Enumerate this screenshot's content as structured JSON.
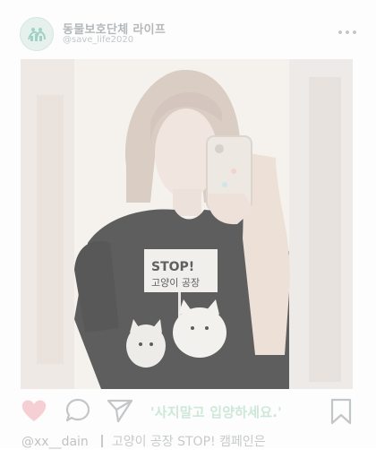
{
  "header": {
    "account_name": "동물보호단체 라이프",
    "account_handle": "@save_life2020",
    "avatar_icon": "paw-logo-icon",
    "more_icon": "more-dots-icon"
  },
  "photo": {
    "shirt_sign_line1": "STOP!",
    "shirt_sign_line2": "고양이 공장"
  },
  "actions": {
    "like_icon": "heart-icon",
    "comment_icon": "comment-bubble-icon",
    "share_icon": "send-icon",
    "save_icon": "bookmark-icon",
    "slogan": "'사지말고 입양하세요.'"
  },
  "caption": {
    "username": "@xx__dain",
    "text": "고양이 공장 STOP! 캠페인은"
  },
  "colors": {
    "heart": "#f6cfd4",
    "slogan": "#cde8d9",
    "icon_stroke": "#c3c6c8"
  }
}
